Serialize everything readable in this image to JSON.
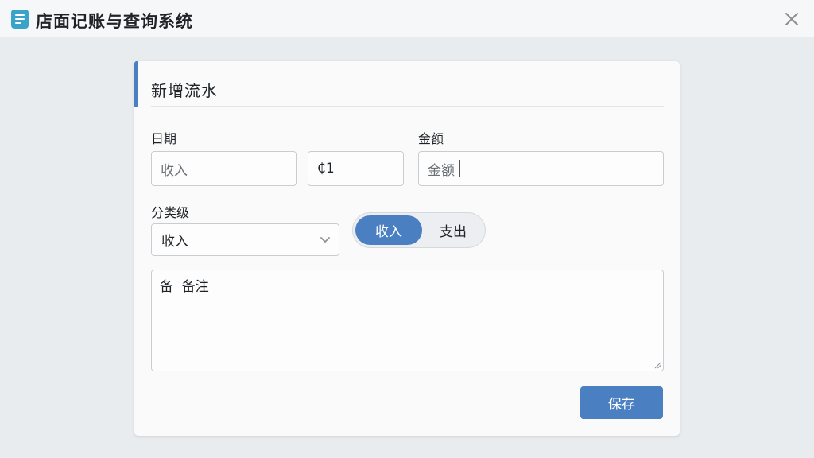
{
  "window": {
    "title": "店面记账与查询系统",
    "app_icon": "document-icon",
    "close_icon": "close-icon"
  },
  "form": {
    "title": "新增流水",
    "date": {
      "label": "日期",
      "type_placeholder": "收入",
      "date_value": "₵1"
    },
    "amount": {
      "label": "金额",
      "placeholder": "金额"
    },
    "category": {
      "label": "分类级",
      "selected": "收入"
    },
    "toggle": {
      "options": [
        "收入",
        "支出"
      ],
      "active_index": 0
    },
    "note": {
      "placeholder": "备  备注"
    },
    "save_label": "保存"
  },
  "colors": {
    "accent": "#4a7fc1",
    "app_icon": "#3aa3c9"
  }
}
